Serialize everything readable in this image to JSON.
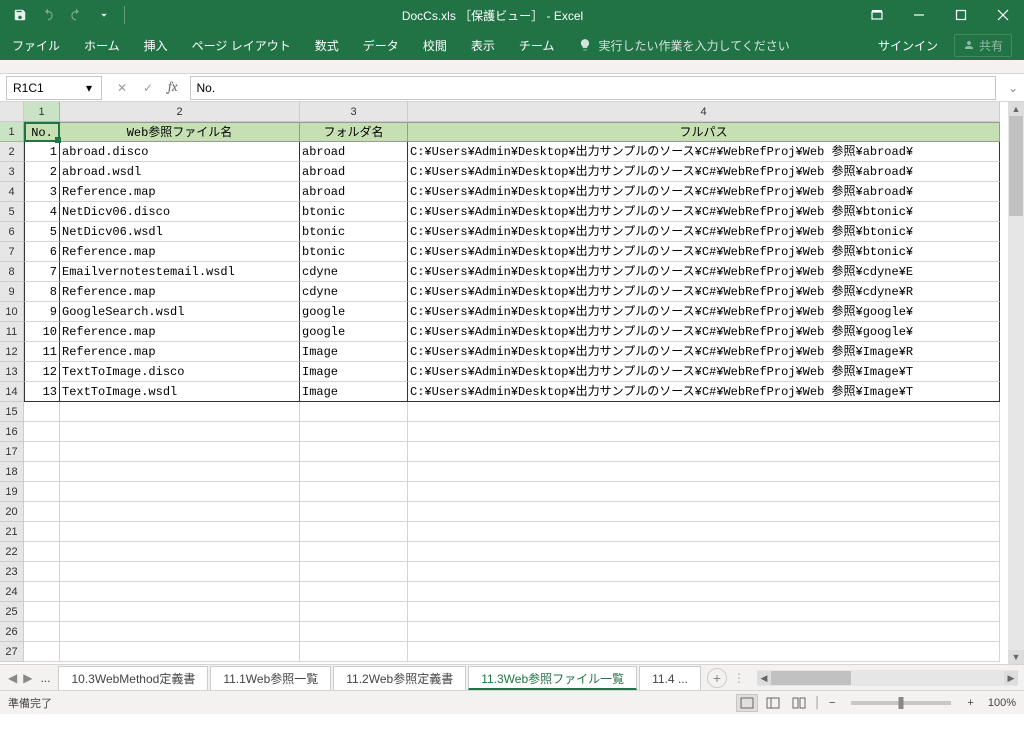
{
  "title": "DocCs.xls ［保護ビュー］ - Excel",
  "ribbon": {
    "file": "ファイル",
    "home": "ホーム",
    "insert": "挿入",
    "page_layout": "ページ レイアウト",
    "formulas": "数式",
    "data": "データ",
    "review": "校閲",
    "view": "表示",
    "team": "チーム",
    "tellme": "実行したい作業を入力してください",
    "signin": "サインイン",
    "share": "共有"
  },
  "formula_bar": {
    "name_box": "R1C1",
    "content": "No."
  },
  "col_headers": [
    "1",
    "2",
    "3",
    "4"
  ],
  "table": {
    "headers": {
      "no": "No.",
      "file": "Web参照ファイル名",
      "folder": "フォルダ名",
      "path": "フルパス"
    },
    "rows": [
      {
        "no": "1",
        "file": "abroad.disco",
        "folder": "abroad",
        "path": "C:¥Users¥Admin¥Desktop¥出力サンプルのソース¥C#¥WebRefProj¥Web 参照¥abroad¥"
      },
      {
        "no": "2",
        "file": "abroad.wsdl",
        "folder": "abroad",
        "path": "C:¥Users¥Admin¥Desktop¥出力サンプルのソース¥C#¥WebRefProj¥Web 参照¥abroad¥"
      },
      {
        "no": "3",
        "file": "Reference.map",
        "folder": "abroad",
        "path": "C:¥Users¥Admin¥Desktop¥出力サンプルのソース¥C#¥WebRefProj¥Web 参照¥abroad¥"
      },
      {
        "no": "4",
        "file": "NetDicv06.disco",
        "folder": "btonic",
        "path": "C:¥Users¥Admin¥Desktop¥出力サンプルのソース¥C#¥WebRefProj¥Web 参照¥btonic¥"
      },
      {
        "no": "5",
        "file": "NetDicv06.wsdl",
        "folder": "btonic",
        "path": "C:¥Users¥Admin¥Desktop¥出力サンプルのソース¥C#¥WebRefProj¥Web 参照¥btonic¥"
      },
      {
        "no": "6",
        "file": "Reference.map",
        "folder": "btonic",
        "path": "C:¥Users¥Admin¥Desktop¥出力サンプルのソース¥C#¥WebRefProj¥Web 参照¥btonic¥"
      },
      {
        "no": "7",
        "file": "Emailvernotestemail.wsdl",
        "folder": "cdyne",
        "path": "C:¥Users¥Admin¥Desktop¥出力サンプルのソース¥C#¥WebRefProj¥Web 参照¥cdyne¥E"
      },
      {
        "no": "8",
        "file": "Reference.map",
        "folder": "cdyne",
        "path": "C:¥Users¥Admin¥Desktop¥出力サンプルのソース¥C#¥WebRefProj¥Web 参照¥cdyne¥R"
      },
      {
        "no": "9",
        "file": "GoogleSearch.wsdl",
        "folder": "google",
        "path": "C:¥Users¥Admin¥Desktop¥出力サンプルのソース¥C#¥WebRefProj¥Web 参照¥google¥"
      },
      {
        "no": "10",
        "file": "Reference.map",
        "folder": "google",
        "path": "C:¥Users¥Admin¥Desktop¥出力サンプルのソース¥C#¥WebRefProj¥Web 参照¥google¥"
      },
      {
        "no": "11",
        "file": "Reference.map",
        "folder": "Image",
        "path": "C:¥Users¥Admin¥Desktop¥出力サンプルのソース¥C#¥WebRefProj¥Web 参照¥Image¥R"
      },
      {
        "no": "12",
        "file": "TextToImage.disco",
        "folder": "Image",
        "path": "C:¥Users¥Admin¥Desktop¥出力サンプルのソース¥C#¥WebRefProj¥Web 参照¥Image¥T"
      },
      {
        "no": "13",
        "file": "TextToImage.wsdl",
        "folder": "Image",
        "path": "C:¥Users¥Admin¥Desktop¥出力サンプルのソース¥C#¥WebRefProj¥Web 参照¥Image¥T"
      }
    ]
  },
  "sheets": {
    "ellipsis": "...",
    "tab1": "10.3WebMethod定義書",
    "tab2": "11.1Web参照一覧",
    "tab3": "11.2Web参照定義書",
    "tab4": "11.3Web参照ファイル一覧",
    "tab5": "11.4 ..."
  },
  "status": {
    "ready": "準備完了",
    "zoom": "100%"
  }
}
